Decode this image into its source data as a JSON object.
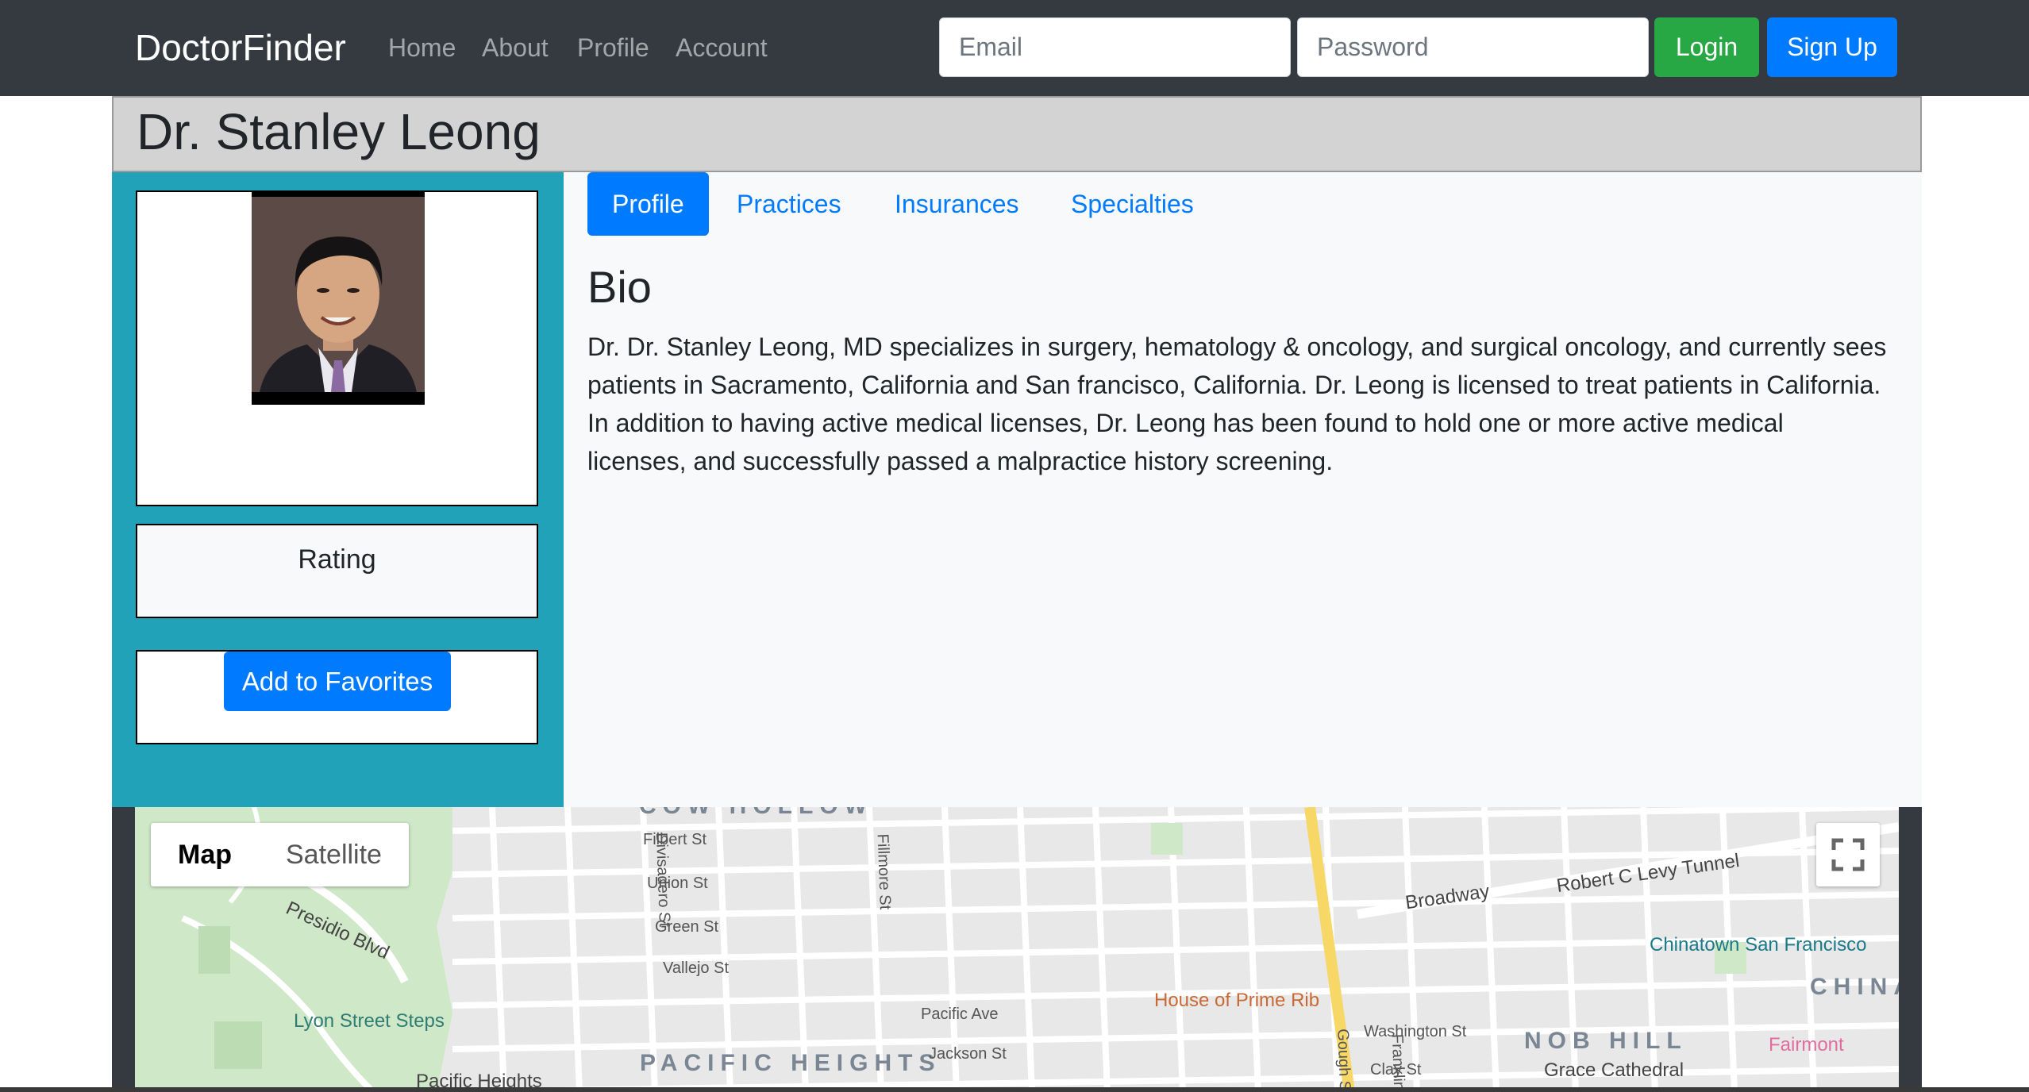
{
  "navbar": {
    "brand": "DoctorFinder",
    "links": [
      "Home",
      "About",
      "Profile",
      "Account"
    ],
    "email_placeholder": "Email",
    "password_placeholder": "Password",
    "login_label": "Login",
    "signup_label": "Sign Up"
  },
  "doctor": {
    "name": "Dr. Stanley Leong",
    "rating_label": "Rating",
    "favorites_label": "Add to Favorites"
  },
  "tabs": [
    "Profile",
    "Practices",
    "Insurances",
    "Specialties"
  ],
  "bio": {
    "title": "Bio",
    "text": "Dr. Dr. Stanley Leong, MD specializes in surgery, hematology & oncology, and surgical oncology, and currently sees patients in Sacramento, California and San francisco, California. Dr. Leong is licensed to treat patients in California. In addition to having active medical licenses, Dr. Leong has been found to hold one or more active medical licenses, and successfully passed a malpractice history screening."
  },
  "map": {
    "type_options": [
      "Map",
      "Satellite"
    ],
    "selected_type": "Map",
    "labels": {
      "cow_hollow": "COW HOLLOW",
      "pacific_heights": "PACIFIC HEIGHTS",
      "nob_hill": "NOB HILL",
      "china": "CHINA",
      "lyon_steps": "Lyon Street Steps",
      "pacific_heights_small": "Pacific Heights",
      "house_prime_rib": "House of Prime Rib",
      "chinatown": "Chinatown San Francisco",
      "grace_cathedral": "Grace Cathedral",
      "fairmont": "Fairmont",
      "robert_levy_tunnel": "Robert C Levy Tunnel",
      "broadway": "Broadway",
      "presidio_blvd": "Presidio Blvd",
      "filbert": "Filbert St",
      "union": "Union St",
      "green": "Green St",
      "vallejo": "Vallejo St",
      "pacific_ave": "Pacific Ave",
      "jackson": "Jackson St",
      "washington": "Washington St",
      "clay": "Clay St",
      "divisadero": "Divisadero St",
      "fillmore": "Fillmore St",
      "gough": "Gough St",
      "franklin": "Franklin"
    }
  }
}
